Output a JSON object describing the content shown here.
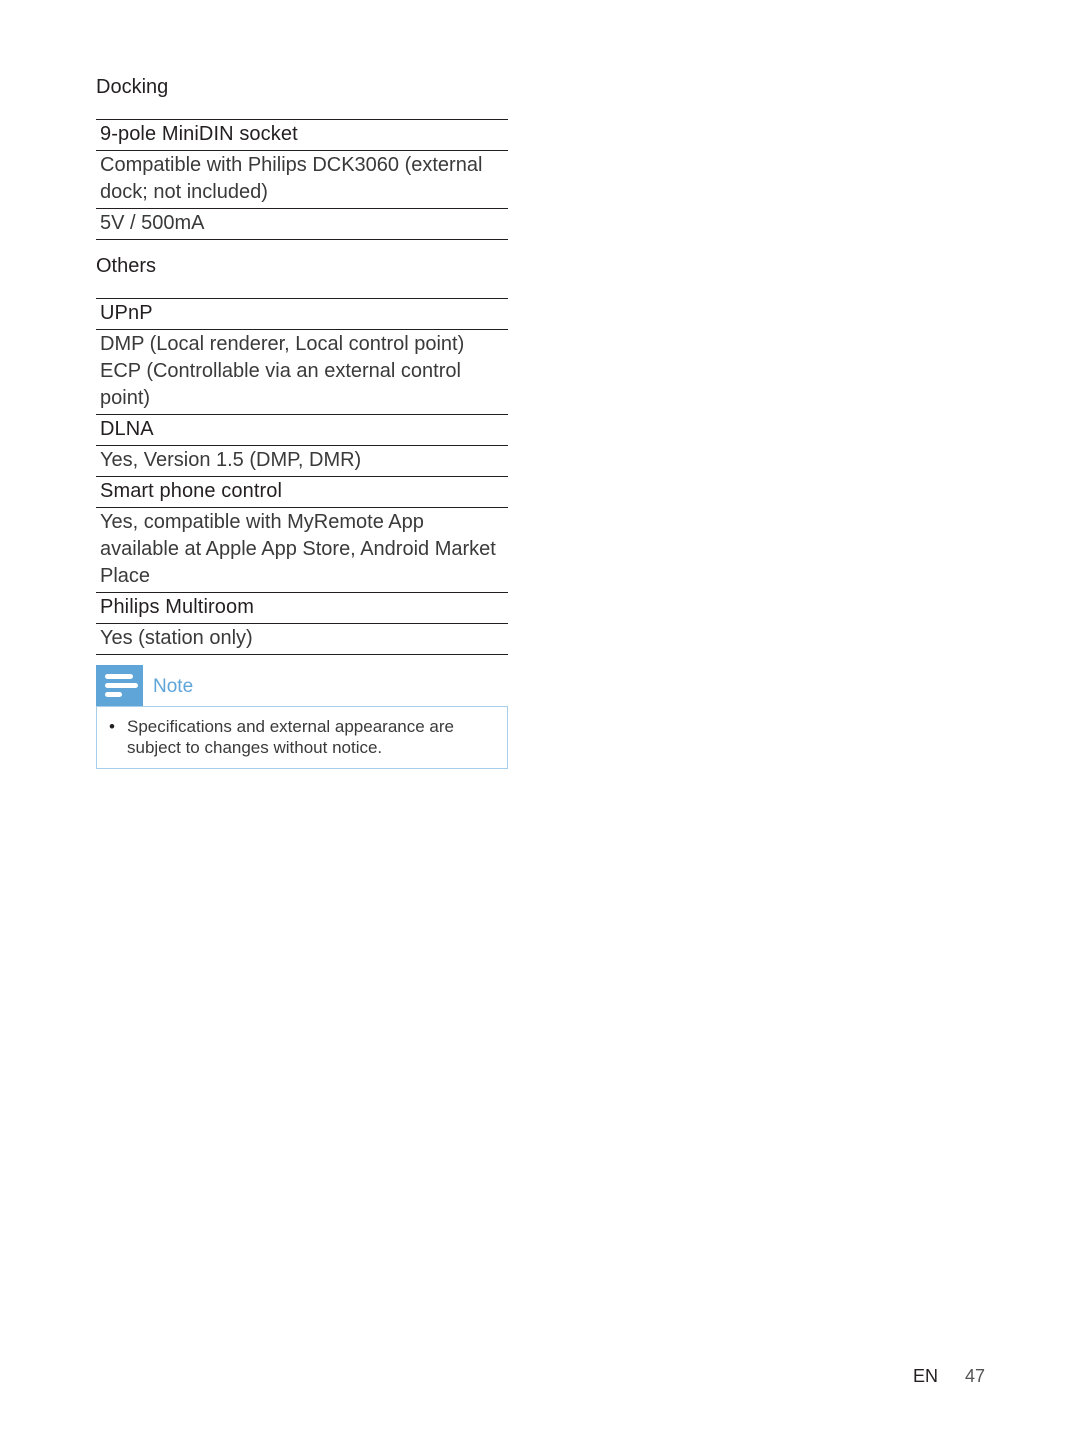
{
  "sections": [
    {
      "title": "Docking",
      "rows": [
        {
          "type": "header",
          "text": "9-pole MiniDIN socket"
        },
        {
          "type": "value",
          "text": "Compatible with Philips DCK3060 (external dock; not included)"
        },
        {
          "type": "value",
          "text": "5V / 500mA"
        }
      ]
    },
    {
      "title": "Others",
      "rows": [
        {
          "type": "header",
          "text": "UPnP"
        },
        {
          "type": "value",
          "text": "DMP (Local renderer, Local control point) ECP (Controllable via an external control point)"
        },
        {
          "type": "header",
          "text": "DLNA"
        },
        {
          "type": "value",
          "text": "Yes, Version 1.5 (DMP, DMR)"
        },
        {
          "type": "header",
          "text": "Smart phone control"
        },
        {
          "type": "value",
          "text": "Yes, compatible with MyRemote App available at Apple App Store, Android Market Place"
        },
        {
          "type": "header",
          "text": "Philips Multiroom"
        },
        {
          "type": "value",
          "text": "Yes (station only)"
        }
      ]
    }
  ],
  "note": {
    "icon": "note-lines-icon",
    "label": "Note",
    "items": [
      "Specifications and external appearance are subject to changes without notice."
    ]
  },
  "footer": {
    "language": "EN",
    "page_number": "47"
  },
  "colors": {
    "accent": "#5fa5d8",
    "note_border": "#a8cde9",
    "text": "#231f20"
  }
}
